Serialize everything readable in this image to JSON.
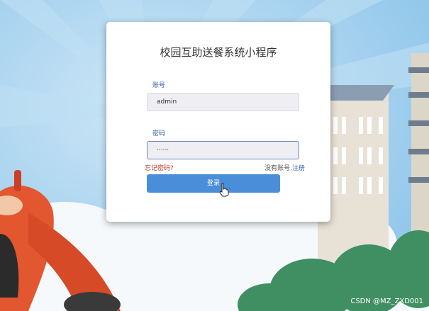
{
  "app": {
    "title": "校园互助送餐系统小程序"
  },
  "form": {
    "account_label": "账号",
    "account_value": "admin",
    "password_label": "密码",
    "password_value": "······",
    "forgot_text": "忘记密码?",
    "register_prefix": "没有账号,",
    "register_link": "注册",
    "login_label": "登录"
  },
  "footer": {
    "watermark": "CSDN @MZ_ZXD001"
  },
  "colors": {
    "accent": "#4a8ed9",
    "label": "#3a63a8",
    "danger": "#c0392b"
  }
}
